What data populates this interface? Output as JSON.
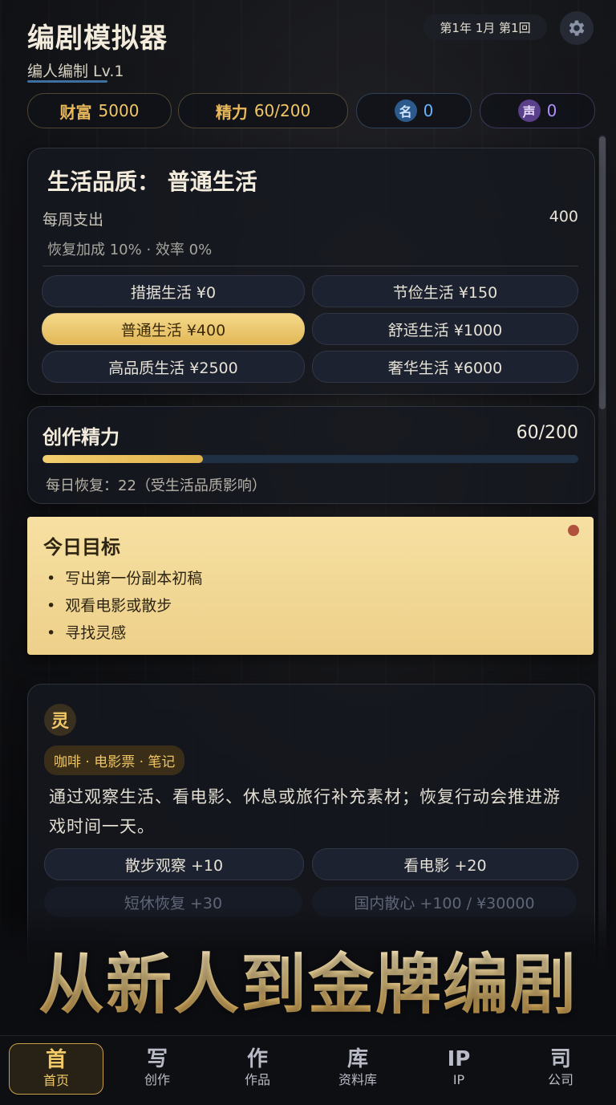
{
  "app": {
    "title": "编剧模拟器",
    "subtitle": "编人编制 Lv.1",
    "date": "第1年 1月 第1回"
  },
  "stats": [
    {
      "tag": "财富",
      "value": "5000"
    },
    {
      "tag": "精力",
      "value": "60/200"
    },
    {
      "tag": "名",
      "value": "0"
    },
    {
      "tag": "声",
      "value": "0"
    }
  ],
  "life": {
    "title": "生活品质： 普通生活",
    "weekly_label": "每周支出",
    "weekly_value": "400",
    "bonus": "恢复加成 10% · 效率 0%",
    "options": [
      "措据生活 ¥0",
      "节俭生活 ¥150",
      "普通生活 ¥400",
      "舒适生活 ¥1000",
      "高品质生活 ¥2500",
      "奢华生活 ¥6000"
    ],
    "selected_index": 2
  },
  "energy": {
    "title": "创作精力",
    "value": "60/200",
    "progress": 0.3,
    "recover": "每日恢复：22（受生活品质影响）"
  },
  "goals": {
    "title": "今日目标",
    "items": [
      "写出第一份副本初稿",
      "观看电影或散步",
      "寻找灵感"
    ]
  },
  "inspire": {
    "icon_char": "灵",
    "chips": "咖啡 · 电影票 · 笔记",
    "desc": "通过观察生活、看电影、休息或旅行补充素材；恢复行动会推进游戏时间一天。",
    "actions": [
      "散步观察 +10",
      "看电影 +20"
    ],
    "faded_actions": [
      "短休恢复 +30",
      "国内散心 +100 / ¥30000"
    ]
  },
  "banner": "从新人到金牌编剧",
  "nav": [
    {
      "glyph": "首",
      "label": "首页"
    },
    {
      "glyph": "写",
      "label": "创作"
    },
    {
      "glyph": "作",
      "label": "作品"
    },
    {
      "glyph": "库",
      "label": "资料库"
    },
    {
      "glyph": "IP",
      "label": "IP"
    },
    {
      "glyph": "司",
      "label": "公司"
    }
  ],
  "colors": {
    "accent": "#f2c967",
    "fame": "#64b4ff",
    "voice": "#b58cff",
    "goal_bg": "#f3d995"
  }
}
